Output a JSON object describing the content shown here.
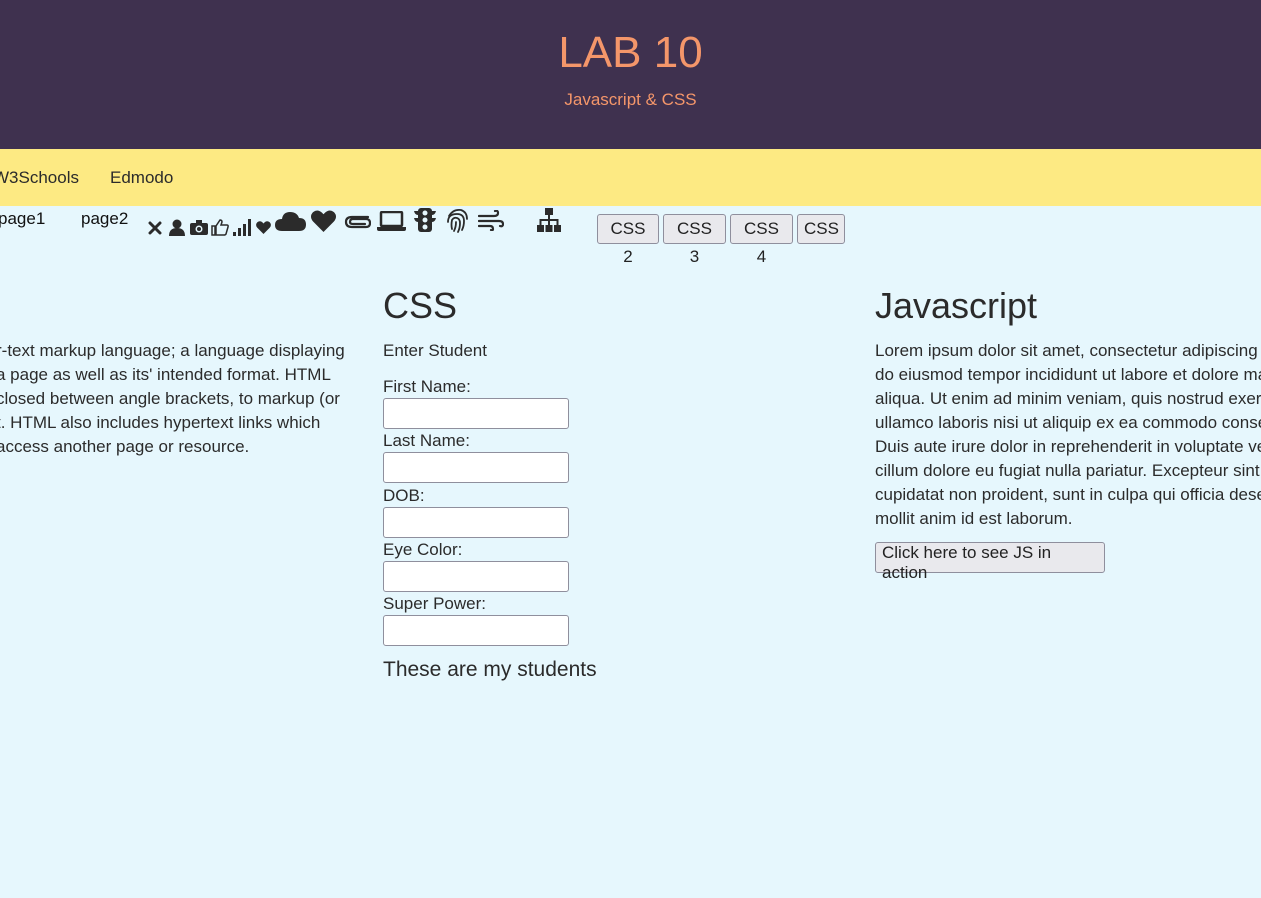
{
  "header": {
    "title": "LAB 10",
    "subtitle": "Javascript & CSS"
  },
  "nav": {
    "links": [
      "W3Schools",
      "Edmodo"
    ]
  },
  "pages": [
    "page1",
    "page2"
  ],
  "icons": [
    "close-icon",
    "user-icon",
    "camera-icon",
    "thumbs-up-icon",
    "signal-icon",
    "heart-icon",
    "cloud-icon",
    "heart-icon",
    "paperclip-icon",
    "laptop-icon",
    "traffic-light-icon",
    "fingerprint-icon",
    "wind-icon",
    "sitemap-icon"
  ],
  "css_buttons": [
    "CSS 2",
    "CSS 3",
    "CSS 4",
    "CSS"
  ],
  "html_section": {
    "lines": [
      "r-text markup language; a language displaying",
      "a page as well as its' intended format. HTML",
      "closed between angle brackets, to markup (or",
      "t. HTML also includes hypertext links which",
      "access another page or resource."
    ]
  },
  "css_section": {
    "heading": "CSS",
    "form_title": "Enter Student",
    "fields": [
      {
        "label": "First Name:",
        "value": ""
      },
      {
        "label": "Last Name:",
        "value": ""
      },
      {
        "label": "DOB:",
        "value": ""
      },
      {
        "label": "Eye Color:",
        "value": ""
      },
      {
        "label": "Super Power:",
        "value": ""
      }
    ],
    "students_heading": "These are my students"
  },
  "js_section": {
    "heading": "Javascript",
    "lines": [
      "Lorem ipsum dolor sit amet, consectetur adipiscing e",
      "do eiusmod tempor incididunt ut labore et dolore ma",
      "aliqua. Ut enim ad minim veniam, quis nostrud exerc",
      "ullamco laboris nisi ut aliquip ex ea commodo conse",
      "Duis aute irure dolor in reprehenderit in voluptate ve",
      "cillum dolore eu fugiat nulla pariatur. Excepteur sint c",
      "cupidatat non proident, sunt in culpa qui officia dese",
      "mollit anim id est laborum."
    ],
    "button": "Click here to see JS in action"
  }
}
